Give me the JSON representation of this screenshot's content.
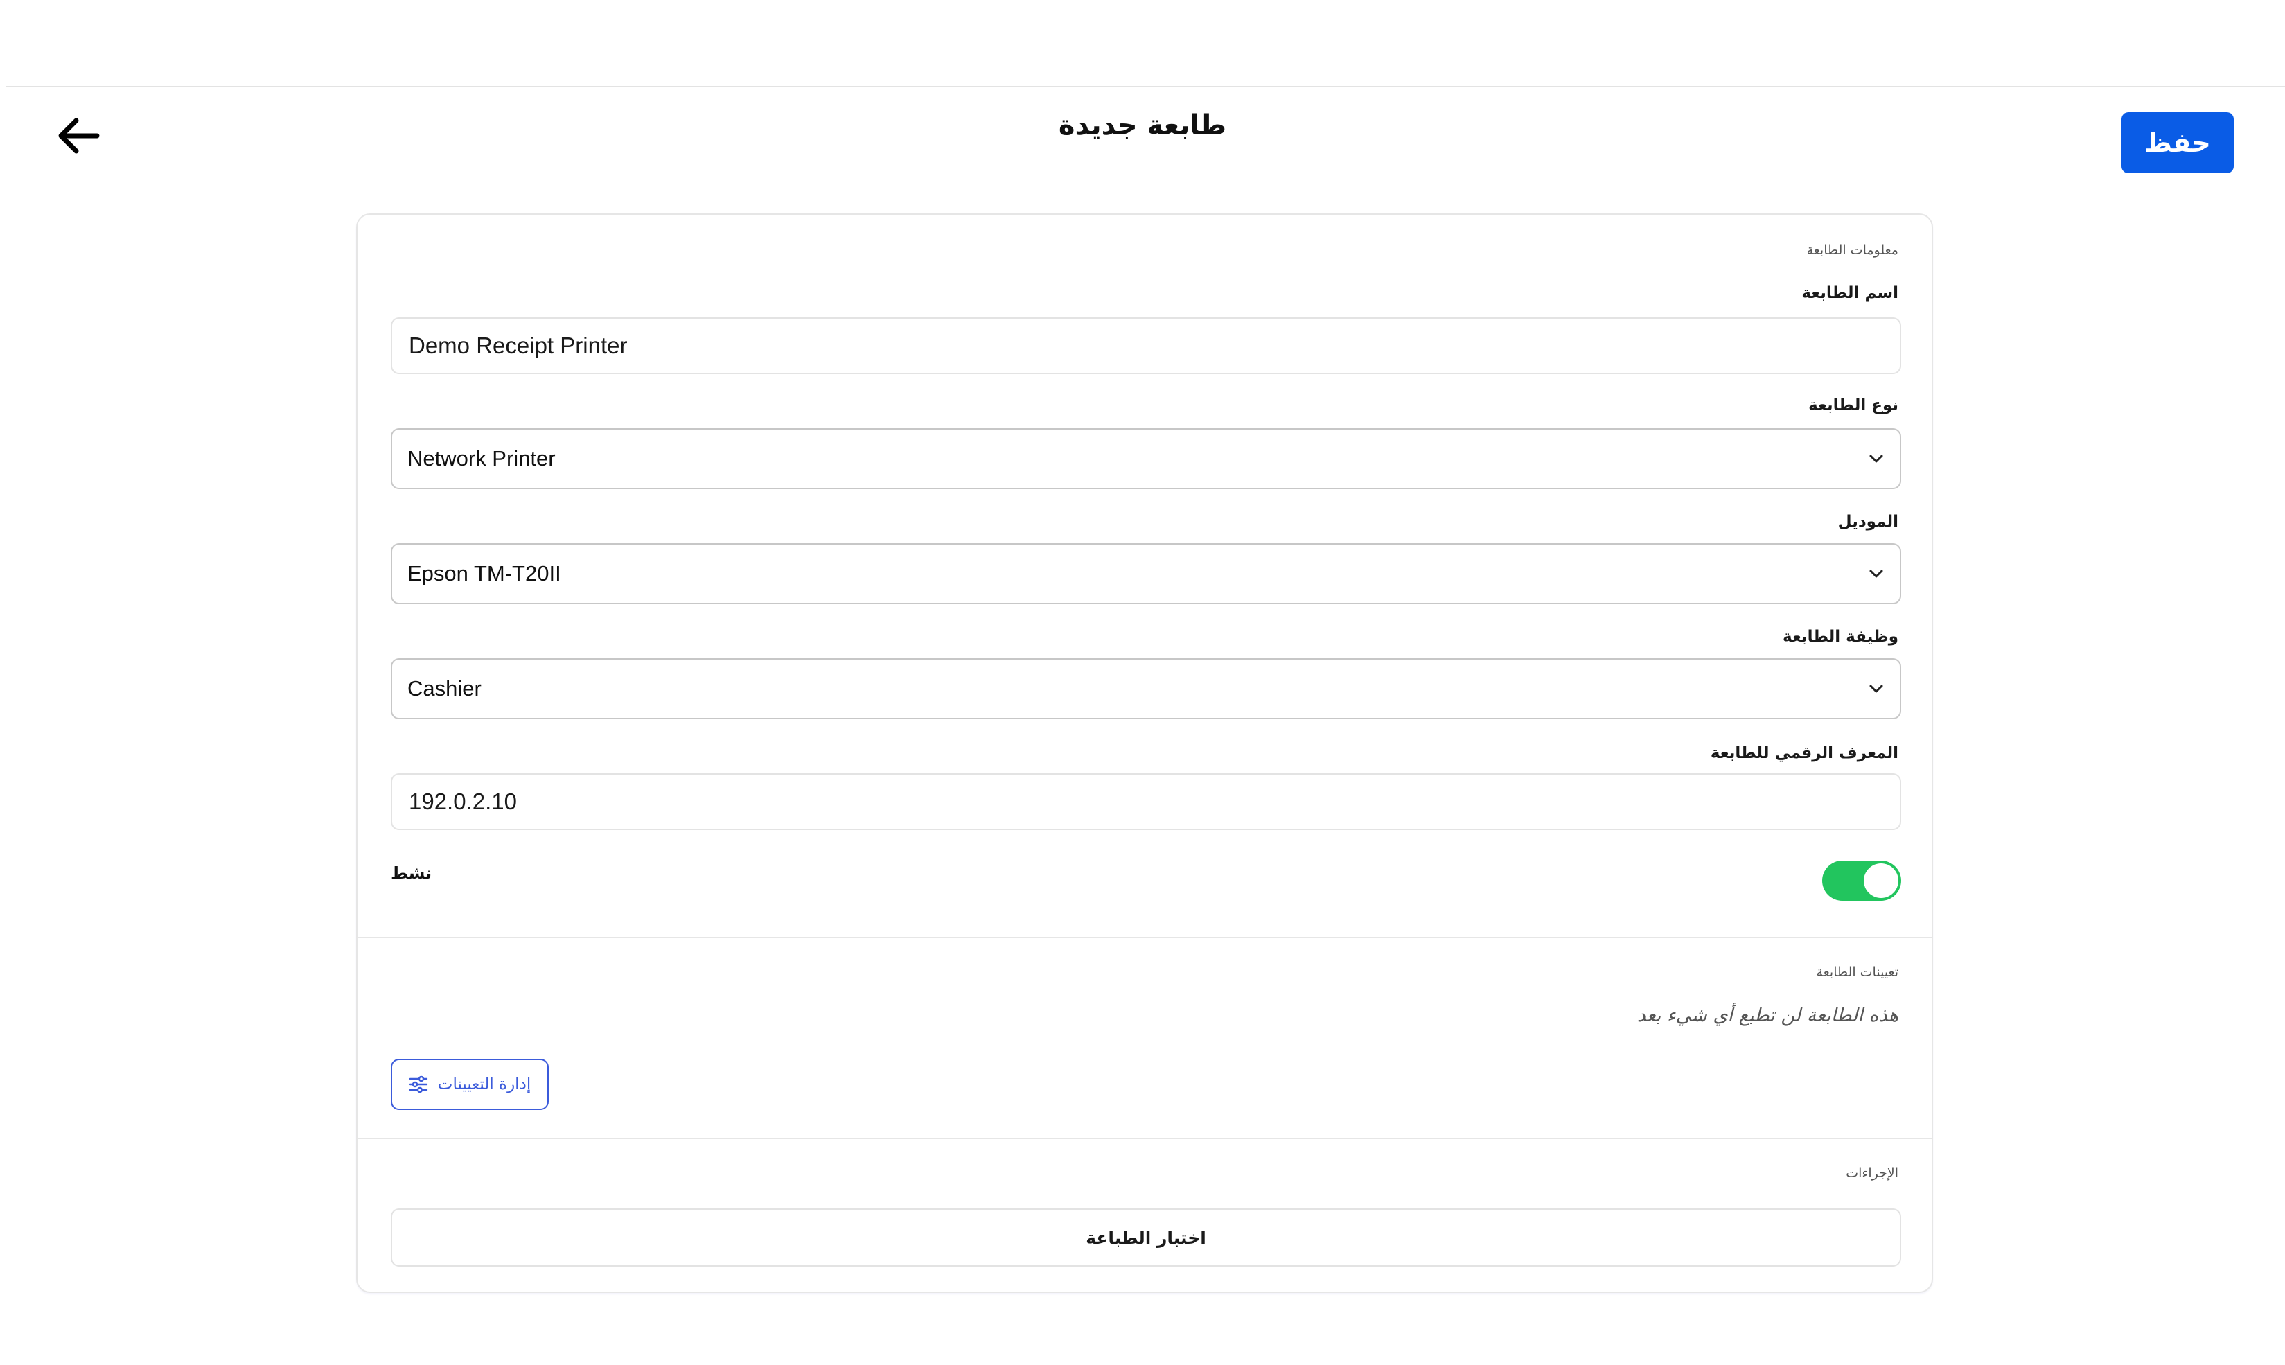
{
  "header": {
    "title": "طابعة جديدة",
    "save_label": "حفظ"
  },
  "printer_info": {
    "section_title": "معلومات الطابعة",
    "name": {
      "label": "اسم الطابعة",
      "value": "Demo Receipt Printer"
    },
    "type": {
      "label": "نوع الطابعة",
      "value": "Network Printer"
    },
    "model": {
      "label": "الموديل",
      "value": "Epson TM-T20II"
    },
    "function": {
      "label": "وظيفة الطابعة",
      "value": "Cashier"
    },
    "ip": {
      "label": "المعرف الرقمي للطابعة",
      "value": "192.0.2.10"
    },
    "active": {
      "label": "نشط",
      "enabled": true
    }
  },
  "assignments": {
    "section_title": "تعيينات الطابعة",
    "empty_text": "هذه الطابعة لن تطبع أي شيء بعد",
    "manage_label": "إدارة التعيينات"
  },
  "actions": {
    "section_title": "الإجراءات",
    "test_print_label": "اختبار الطباعة"
  },
  "colors": {
    "primary": "#0a5ce6",
    "toggle_on": "#22c55e",
    "manage_accent": "#3b5bdb"
  },
  "icons": {
    "back": "arrow-left-icon",
    "select": "chevron-down-icon",
    "manage": "sliders-icon"
  }
}
